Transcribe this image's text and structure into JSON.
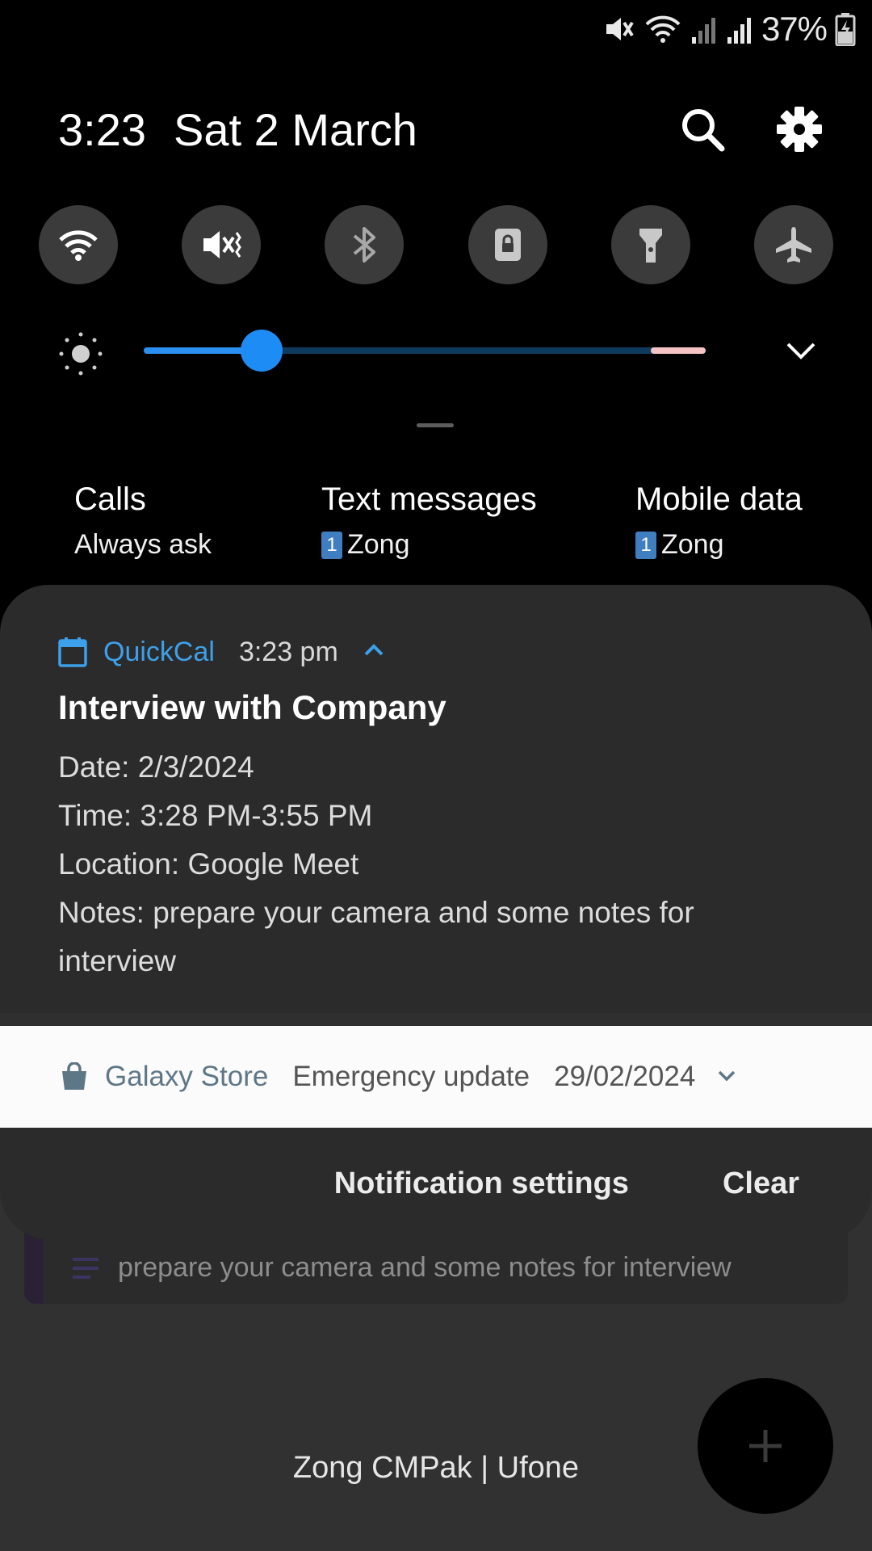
{
  "status_bar": {
    "battery_percent": "37%",
    "icons": [
      "mute-icon",
      "wifi-icon",
      "signal-1-icon",
      "signal-2-icon",
      "battery-charging-icon"
    ]
  },
  "quick_panel": {
    "time": "3:23",
    "date": "Sat 2 March",
    "toggles": [
      {
        "name": "wifi",
        "on": true
      },
      {
        "name": "mute",
        "on": true
      },
      {
        "name": "bluetooth",
        "on": false
      },
      {
        "name": "screen-lock",
        "on": false
      },
      {
        "name": "flashlight",
        "on": false
      },
      {
        "name": "airplane",
        "on": false
      }
    ],
    "brightness_level": 0.21
  },
  "sim": {
    "calls": {
      "title": "Calls",
      "value": "Always ask"
    },
    "texts": {
      "title": "Text messages",
      "sim": "1",
      "value": "Zong"
    },
    "data": {
      "title": "Mobile data",
      "sim": "1",
      "value": "Zong"
    }
  },
  "notification": {
    "app": "QuickCal",
    "time": "3:23 pm",
    "title": "Interview with Company",
    "lines": [
      "Date: 2/3/2024",
      "Time: 3:28 PM-3:55 PM",
      "Location: Google Meet",
      "Notes: prepare your camera and some notes for interview"
    ]
  },
  "store_notification": {
    "app": "Galaxy Store",
    "text": "Emergency update",
    "date": "29/02/2024"
  },
  "footer": {
    "settings": "Notification settings",
    "clear": "Clear"
  },
  "background_app": {
    "note_text": "prepare your camera and some notes for interview",
    "carrier": "Zong CMPak | Ufone"
  },
  "colors": {
    "accent_blue": "#3e8af0",
    "quickcal_blue": "#3da0ea",
    "panel_bg": "#2b2b2b"
  }
}
